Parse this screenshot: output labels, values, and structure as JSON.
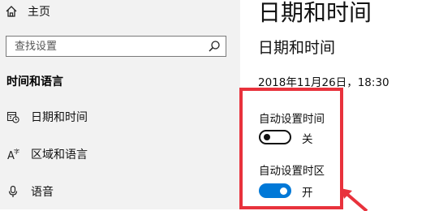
{
  "nav": {
    "home_label": "主页",
    "search_placeholder": "查找设置",
    "section_title": "时间和语言",
    "items": [
      {
        "label": "日期和时间",
        "icon": "calendar-clock-icon"
      },
      {
        "label": "区域和语言",
        "icon": "language-icon"
      },
      {
        "label": "语音",
        "icon": "microphone-icon"
      }
    ]
  },
  "main": {
    "page_title": "日期和时间",
    "section_title": "日期和时间",
    "current_datetime": "2018年11月26日，18:30",
    "auto_time": {
      "label": "自动设置时间",
      "state": "关",
      "on": false
    },
    "auto_timezone": {
      "label": "自动设置时区",
      "state": "开",
      "on": true
    }
  },
  "colors": {
    "accent": "#0078d7",
    "highlight": "#e8323c",
    "nav_bg": "#f2f2f2"
  }
}
